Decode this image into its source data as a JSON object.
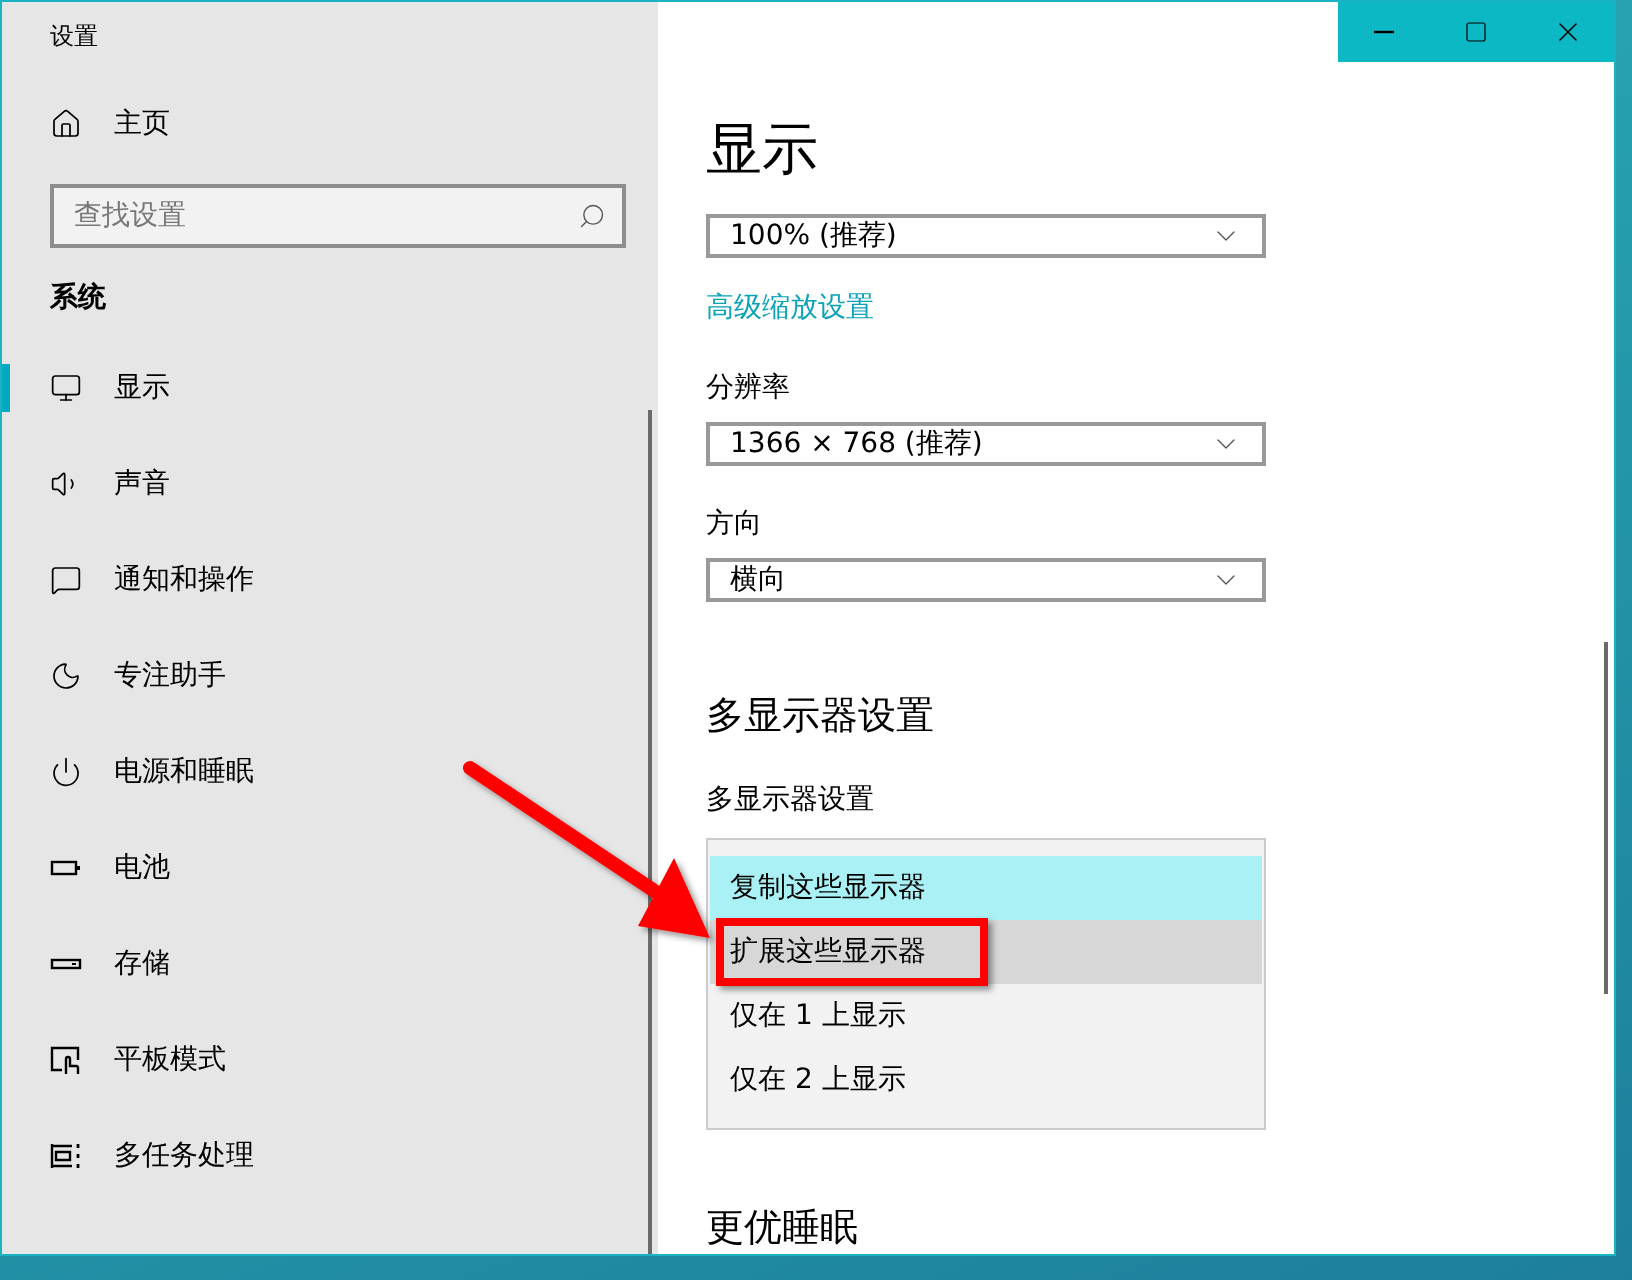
{
  "window": {
    "title": "设置"
  },
  "sidebar": {
    "home": "主页",
    "search": {
      "placeholder": "查找设置"
    },
    "section": "系统",
    "items": [
      {
        "label": "显示",
        "selected": true
      },
      {
        "label": "声音",
        "selected": false
      },
      {
        "label": "通知和操作",
        "selected": false
      },
      {
        "label": "专注助手",
        "selected": false
      },
      {
        "label": "电源和睡眠",
        "selected": false
      },
      {
        "label": "电池",
        "selected": false
      },
      {
        "label": "存储",
        "selected": false
      },
      {
        "label": "平板模式",
        "selected": false
      },
      {
        "label": "多任务处理",
        "selected": false
      }
    ]
  },
  "content": {
    "title": "显示",
    "scale": {
      "value": "100% (推荐)",
      "link": "高级缩放设置"
    },
    "resolution": {
      "label": "分辨率",
      "value": "1366 × 768 (推荐)"
    },
    "orientation": {
      "label": "方向",
      "value": "横向"
    },
    "multi_display": {
      "heading": "多显示器设置",
      "label": "多显示器设置",
      "options": [
        {
          "label": "复制这些显示器",
          "selected": true,
          "hovered": false,
          "annotated": false
        },
        {
          "label": "扩展这些显示器",
          "selected": false,
          "hovered": true,
          "annotated": true
        },
        {
          "label": "仅在 1 上显示",
          "selected": false,
          "hovered": false,
          "annotated": false
        },
        {
          "label": "仅在 2 上显示",
          "selected": false,
          "hovered": false,
          "annotated": false
        }
      ]
    },
    "next_heading": "更优睡眠"
  }
}
